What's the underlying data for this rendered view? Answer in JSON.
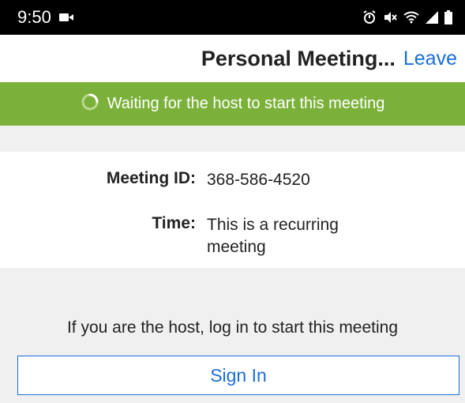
{
  "status_bar": {
    "time": "9:50",
    "icons": [
      "video-camera-icon",
      "alarm-icon",
      "mute-icon",
      "wifi-icon",
      "signal-icon",
      "battery-icon"
    ]
  },
  "header": {
    "title": "Personal Meeting...",
    "leave_label": "Leave"
  },
  "banner": {
    "text": "Waiting for the host to start this meeting",
    "color": "#7bb13a",
    "icon": "loading-spinner-icon"
  },
  "meeting_info": {
    "id_label": "Meeting ID:",
    "id_value": "368-586-4520",
    "time_label": "Time:",
    "time_value": "This is a recurring meeting"
  },
  "host_section": {
    "prompt": "If you are the host, log in to start this meeting",
    "sign_in_label": "Sign In"
  },
  "colors": {
    "accent": "#1a6ed8",
    "background_gray": "#f0f0f1"
  }
}
